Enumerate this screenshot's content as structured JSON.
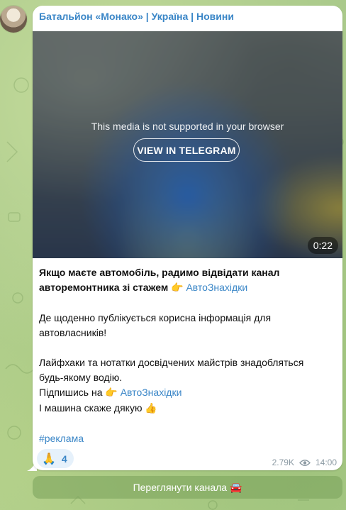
{
  "channel": {
    "name": "Батальйон «Монако» | Україна | Новини",
    "avatar_icon": "channel-avatar"
  },
  "media": {
    "unsupported_text": "This media is not supported in your browser",
    "view_button_label": "VIEW IN TELEGRAM",
    "duration": "0:22"
  },
  "message": {
    "line1_bold": "Якщо маєте автомобіль, радимо відвідати канал",
    "line2_bold": "авторемонтника зі стажем",
    "point_emoji": "👉",
    "link1": "АвтоЗнахідки",
    "line3": "Де щоденно публікується корисна інформація для",
    "line4": "автовласників!",
    "line5": "Лайфхаки та нотатки досвідчених майстрів знадобляться",
    "line6": "будь-якому водію.",
    "line7_prefix": "Підпишись на",
    "link2": "АвтоЗнахідки",
    "line8": "І машина скаже дякую",
    "thumbs_emoji": "👍",
    "hashtag": "#реклама"
  },
  "reaction": {
    "emoji": "🙏",
    "count": "4"
  },
  "meta": {
    "views": "2.79K",
    "views_icon": "eye-icon",
    "time": "14:00"
  },
  "view_channel_button": {
    "label": "Переглянути канала",
    "emoji": "🚘"
  },
  "colors": {
    "accent": "#3a86c7",
    "background": "#a9c98a",
    "bubble": "#ffffff"
  }
}
